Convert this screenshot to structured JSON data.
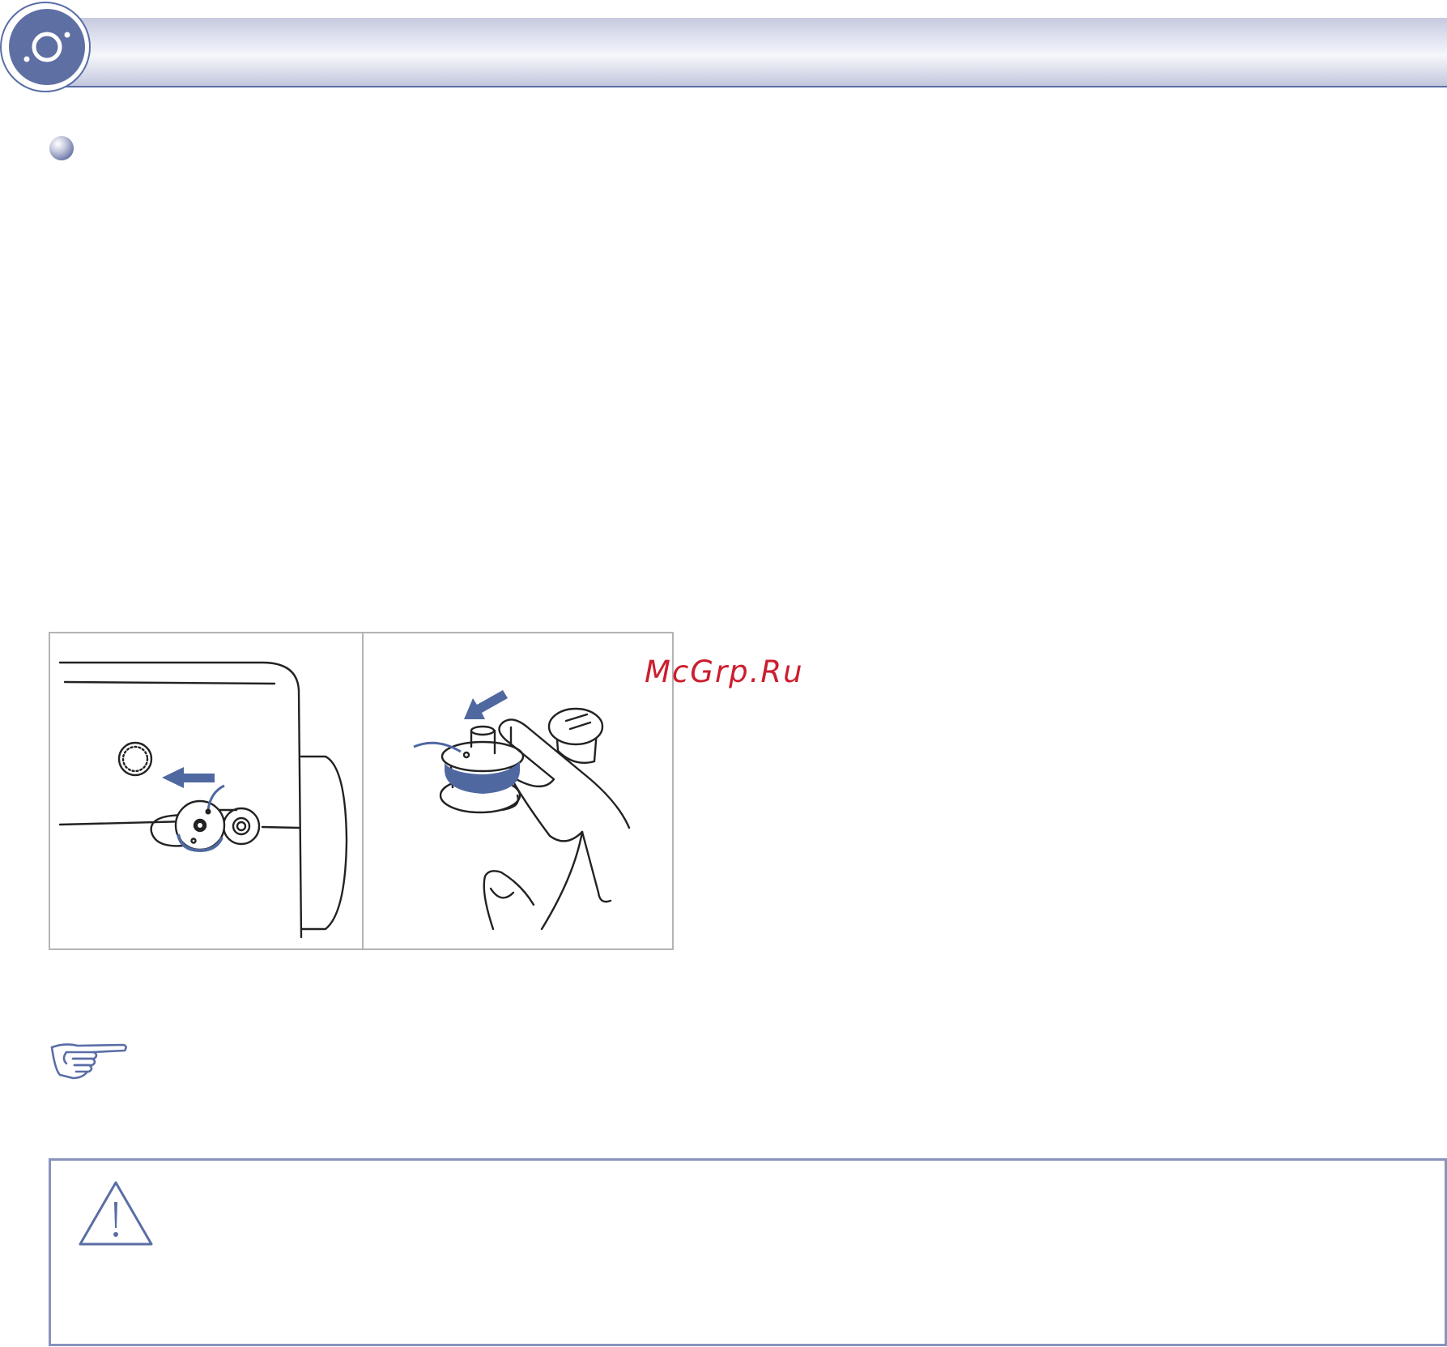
{
  "header": {
    "badge_icon": "bobbin-disc-icon",
    "colors": {
      "accent": "#5a6ea5",
      "badge_fill": "#5e6fa3",
      "bar_light": "#eceef7",
      "bar_dark": "#c3c7dd"
    }
  },
  "section": {
    "bullet_icon": "sphere-bullet-icon"
  },
  "figure": {
    "left_panel": {
      "illustration": "bobbin-winder-spindle-icon",
      "arrow_icon": "arrow-left-icon"
    },
    "right_panel": {
      "illustration": "bobbin-on-spindle-hand-icon",
      "arrow_icon": "arrow-down-left-icon"
    },
    "thread_color": "#4f68a0"
  },
  "watermark": {
    "text": "McGrp.Ru",
    "color": "#cc1e2e"
  },
  "note": {
    "icon": "pointing-hand-icon"
  },
  "warning": {
    "icon": "warning-triangle-icon",
    "border_color": "#8a93bd"
  }
}
